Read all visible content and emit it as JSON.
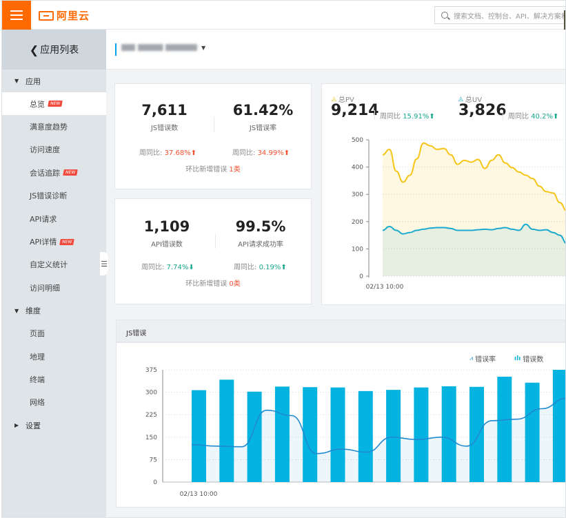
{
  "brand": {
    "name": "阿里云",
    "color": "#ff6a00"
  },
  "search": {
    "placeholder": "搜索文档、控制台、API、解决方案和"
  },
  "sidebar": {
    "back_label": "应用列表",
    "groups": [
      {
        "label": "应用",
        "expanded": true
      },
      {
        "label": "维度",
        "expanded": true
      },
      {
        "label": "设置",
        "expanded": false
      }
    ],
    "app_items": [
      {
        "label": "总览",
        "badge": "NEW",
        "active": true
      },
      {
        "label": "满意度趋势"
      },
      {
        "label": "访问速度"
      },
      {
        "label": "会话追踪",
        "badge": "NEW"
      },
      {
        "label": "JS错误诊断"
      },
      {
        "label": "API请求"
      },
      {
        "label": "API详情",
        "badge": "NEW"
      },
      {
        "label": "自定义统计"
      },
      {
        "label": "访问明细"
      }
    ],
    "dim_items": [
      {
        "label": "页面"
      },
      {
        "label": "地理"
      },
      {
        "label": "终端"
      },
      {
        "label": "网络"
      }
    ]
  },
  "js_card": {
    "errors": {
      "value": "7,611",
      "label": "JS错误数",
      "cmp_label": "周同比:",
      "cmp_value": "37.68%",
      "dir": "up"
    },
    "rate": {
      "value": "61.42%",
      "label": "JS错误率",
      "cmp_label": "周同比:",
      "cmp_value": "34.99%",
      "dir": "up"
    },
    "new_label": "环比新增错误",
    "new_value": "1类"
  },
  "api_card": {
    "errors": {
      "value": "1,109",
      "label": "API错误数",
      "cmp_label": "周同比:",
      "cmp_value": "7.74%",
      "dir": "down"
    },
    "success": {
      "value": "99.5%",
      "label": "API请求成功率",
      "cmp_label": "周同比:",
      "cmp_value": "0.19%",
      "dir": "up"
    },
    "new_label": "环比新增错误",
    "new_value": "0类"
  },
  "pvuv": {
    "pv": {
      "title": "总PV",
      "value": "9,214",
      "cmp_label": "周同比",
      "cmp_value": "15.91%"
    },
    "uv": {
      "title": "总UV",
      "value": "3,826",
      "cmp_label": "周同比",
      "cmp_value": "40.2%"
    }
  },
  "js_section": {
    "title": "JS错误"
  },
  "chart_data": [
    {
      "type": "area",
      "y_ticks": [
        "0",
        "100",
        "200",
        "300",
        "400",
        "500"
      ],
      "ylim": [
        0,
        500
      ],
      "x_tick": "02/13 10:00",
      "grid": true,
      "series": [
        {
          "name": "总PV",
          "color": "#f5c518",
          "values": [
            445,
            465,
            385,
            345,
            370,
            430,
            488,
            478,
            465,
            468,
            445,
            410,
            425,
            418,
            428,
            395,
            425,
            445,
            415,
            398,
            382,
            370,
            358,
            330,
            310,
            305,
            270,
            240
          ]
        },
        {
          "name": "总UV",
          "color": "#1aa9cf",
          "values": [
            168,
            182,
            168,
            155,
            160,
            168,
            172,
            176,
            178,
            178,
            175,
            168,
            168,
            168,
            170,
            172,
            170,
            175,
            178,
            172,
            168,
            190,
            172,
            168,
            170,
            160,
            150,
            120
          ]
        }
      ]
    },
    {
      "type": "bar",
      "y_ticks": [
        "0",
        "75",
        "150",
        "225",
        "300",
        "375"
      ],
      "ylim": [
        0,
        375
      ],
      "x_tick": "02/13 10:00",
      "grid": true,
      "legend": [
        "错误率",
        "错误数"
      ],
      "bar_series": {
        "name": "错误数",
        "color": "#05b3e0",
        "values": [
          307,
          342,
          302,
          319,
          317,
          316,
          304,
          308,
          316,
          320,
          318,
          352,
          332,
          375
        ]
      },
      "line_series": {
        "name": "错误率",
        "color": "#1f8ad0",
        "values": [
          125,
          120,
          118,
          240,
          222,
          95,
          110,
          100,
          150,
          142,
          150,
          120,
          205,
          210,
          245,
          280
        ]
      }
    }
  ]
}
